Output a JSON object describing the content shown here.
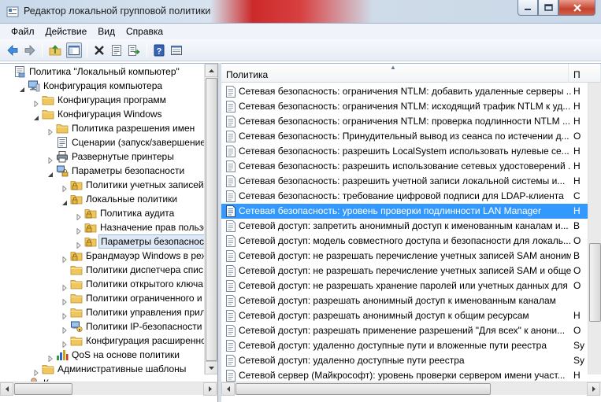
{
  "window": {
    "title": "Редактор локальной групповой политики"
  },
  "menu": [
    "Файл",
    "Действие",
    "Вид",
    "Справка"
  ],
  "toolbar": {
    "buttons": [
      "back-icon",
      "forward-icon",
      "up-folder-icon",
      "show-hide-tree-icon",
      "delete-icon",
      "properties-icon",
      "export-list-icon",
      "help-icon",
      "view-icon"
    ]
  },
  "tree": {
    "items": [
      {
        "label": "Политика \"Локальный компьютер\"",
        "icon": "computer-policy-icon"
      },
      {
        "label": "Конфигурация компьютера",
        "icon": "computer-icon"
      },
      {
        "label": "Конфигурация программ",
        "icon": "folder-icon"
      },
      {
        "label": "Конфигурация Windows",
        "icon": "folder-icon"
      },
      {
        "label": "Политика разрешения имен",
        "icon": "folder-icon"
      },
      {
        "label": "Сценарии (запуск/завершение",
        "icon": "scripts-icon"
      },
      {
        "label": "Развернутые принтеры",
        "icon": "printer-icon"
      },
      {
        "label": "Параметры безопасности",
        "icon": "security-icon"
      },
      {
        "label": "Политики учетных записей",
        "icon": "folder-lock-icon"
      },
      {
        "label": "Локальные политики",
        "icon": "folder-lock-icon"
      },
      {
        "label": "Политика аудита",
        "icon": "folder-lock-icon"
      },
      {
        "label": "Назначение прав пользо",
        "icon": "folder-lock-icon"
      },
      {
        "label": "Параметры безопасност",
        "icon": "folder-lock-icon"
      },
      {
        "label": "Брандмауэр Windows в реж",
        "icon": "folder-lock-icon"
      },
      {
        "label": "Политики диспетчера спис",
        "icon": "folder-icon"
      },
      {
        "label": "Политики открытого ключа",
        "icon": "folder-icon"
      },
      {
        "label": "Политики ограниченного и",
        "icon": "folder-icon"
      },
      {
        "label": "Политики управления прил",
        "icon": "folder-icon"
      },
      {
        "label": "Политики IP-безопасности",
        "icon": "ipsec-icon"
      },
      {
        "label": "Конфигурация расширенно",
        "icon": "folder-icon"
      },
      {
        "label": "QoS на основе политики",
        "icon": "qos-chart-icon"
      },
      {
        "label": "Административные шаблоны",
        "icon": "folder-icon"
      },
      {
        "label": "К",
        "icon": "user-icon"
      }
    ]
  },
  "list": {
    "columns": [
      "Политика",
      "П"
    ],
    "rows": [
      {
        "name": "Сетевая безопасность: ограничения NTLM: добавить удаленные серверы ...",
        "value": "Н"
      },
      {
        "name": "Сетевая безопасность: ограничения NTLM: исходящий трафик NTLM к уд...",
        "value": "Н"
      },
      {
        "name": "Сетевая безопасность: ограничения NTLM: проверка подлинности NTLM ...",
        "value": "Н"
      },
      {
        "name": "Сетевая безопасность: Принудительный вывод из сеанса по истечении д...",
        "value": "О"
      },
      {
        "name": "Сетевая безопасность: разрешить LocalSystem использовать нулевые се...",
        "value": "Н"
      },
      {
        "name": "Сетевая безопасность: разрешить использование сетевых удостоверений ...",
        "value": "Н"
      },
      {
        "name": "Сетевая безопасность: разрешить учетной записи локальной системы и...",
        "value": "Н"
      },
      {
        "name": "Сетевая безопасность: требование цифровой подписи для LDAP-клиента",
        "value": "С"
      },
      {
        "name": "Сетевая безопасность: уровень проверки подлинности LAN Manager",
        "value": "Н"
      },
      {
        "name": "Сетевой доступ: запретить анонимный доступ к именованным каналам и...",
        "value": "В"
      },
      {
        "name": "Сетевой доступ: модель совместного доступа и безопасности для локаль...",
        "value": "О"
      },
      {
        "name": "Сетевой доступ: не разрешать перечисление учетных записей SAM аноним...",
        "value": "В"
      },
      {
        "name": "Сетевой доступ: не разрешать перечисление учетных записей SAM и обще...",
        "value": "О"
      },
      {
        "name": "Сетевой доступ: не разрешать хранение паролей или учетных данных для ...",
        "value": "О"
      },
      {
        "name": "Сетевой доступ: разрешать анонимный доступ к именованным каналам",
        "value": ""
      },
      {
        "name": "Сетевой доступ: разрешать анонимный доступ к общим ресурсам",
        "value": "Н"
      },
      {
        "name": "Сетевой доступ: разрешать применение разрешений \"Для всех\" к анони...",
        "value": "О"
      },
      {
        "name": "Сетевой доступ: удаленно доступные пути и вложенные пути реестра",
        "value": "Sy"
      },
      {
        "name": "Сетевой доступ: удаленно доступные пути реестра",
        "value": "Sy"
      },
      {
        "name": "Сетевой сервер (Майкрософт): уровень проверки сервером имени участ...",
        "value": "Н"
      }
    ],
    "selected_index": 8
  },
  "colors": {
    "selection": "#3399ff",
    "tree_selection": "#dfe9f5",
    "folder": "#f0c75e"
  }
}
